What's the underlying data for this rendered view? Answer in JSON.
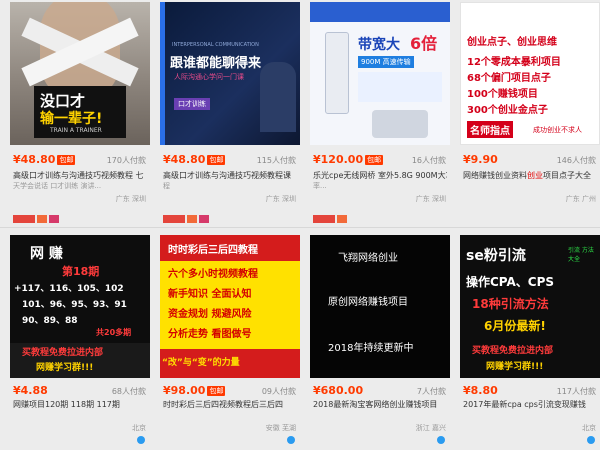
{
  "products": [
    {
      "thumb": {
        "line1": "没口才",
        "line2": "输一辈子!",
        "line3": "TRAIN A TRAINER"
      },
      "price": "¥48.80",
      "tag": "包邮",
      "sold": "170人付款",
      "title": "高级口才训练与沟通技巧视频教程 七",
      "sub": "天学会说话 口才训练 演讲...",
      "location": "广东 深圳"
    },
    {
      "thumb": {
        "line1": "跟谁都能聊得来",
        "line2": "人际沟通心学问一门课",
        "line3": "口才训练",
        "header": "INTERPERSONAL COMMUNICATION"
      },
      "price": "¥48.80",
      "tag": "包邮",
      "sold": "115人付款",
      "title": "高级口才训练与沟通技巧视频教程课",
      "sub": "程",
      "location": "广东 深圳"
    },
    {
      "thumb": {
        "line1": "带宽大",
        "line2": "6倍",
        "line3": "900M 高速传输"
      },
      "price": "¥120.00",
      "tag": "包邮",
      "sold": "16人付款",
      "title": "乐光cpe无线网桥 室外5.8G 900M大功",
      "sub": "率...",
      "location": "广东 深圳"
    },
    {
      "thumb": {
        "line1": "创业点子、创业思维",
        "line2": "12个零成本暴利项目",
        "line3": "68个偏门项目点子",
        "line4": "100个赚钱项目",
        "line5": "300个创业金点子",
        "line6": "名师指点",
        "line7": "成功创业不求人"
      },
      "price": "¥9.90",
      "tag": "",
      "sold": "146人付款",
      "title": "网络赚钱创业资料",
      "title_hl": "创业",
      "title_rest": "项目点子大全",
      "sub": "",
      "location": "广东 广州"
    },
    {
      "thumb": {
        "line1": "网 赚",
        "line2": "第18期",
        "line3": "+117、116、105、102",
        "line4": "101、96、95、93、91",
        "line5": "90、89、88",
        "line6": "共20多期",
        "line7": "买教程免费拉进内部",
        "line8": "网赚学习群!!!"
      },
      "price": "¥4.88",
      "tag": "",
      "sold": "68人付款",
      "title": "网赚项目120期 118期 117期",
      "sub": "",
      "location": "北京"
    },
    {
      "thumb": {
        "line1": "时时彩后三后四教程",
        "line2": "六个多小时视频教程",
        "line3": "新手知识   全面认知",
        "line4": "资金规划   规避风险",
        "line5": "分析走势   看图做号",
        "line6": "“改”与“变”的力量"
      },
      "price": "¥98.00",
      "tag": "包邮",
      "sold": "09人付款",
      "title": "时时彩后三后四视频教程后三后四",
      "sub": "",
      "location": "安徽 芜湖"
    },
    {
      "thumb": {
        "line1": "飞翔网络创业",
        "line2": "原创网络赚钱项目",
        "line3": "2018年持续更新中"
      },
      "price": "¥680.00",
      "tag": "",
      "sold": "7人付款",
      "title": "2018最新淘宝客网络创业赚钱项目",
      "sub": "",
      "location": "浙江 嘉兴"
    },
    {
      "thumb": {
        "line1": "se粉引流",
        "line1b": "引流 方法大全",
        "line2": "操作CPA、CPS",
        "line3": "18种引流方法",
        "line4": "6月份最新!",
        "line5": "买教程免费拉进内部",
        "line6": "网赚学习群!!!"
      },
      "price": "¥8.80",
      "tag": "",
      "sold": "117人付款",
      "title": "2017年最新cpa cps引流变现赚钱",
      "sub": "",
      "location": "北京"
    }
  ],
  "colors": {
    "price": "#ff3a00",
    "badge_red": "#e4453c",
    "wangwang": "#2a9bf0"
  }
}
